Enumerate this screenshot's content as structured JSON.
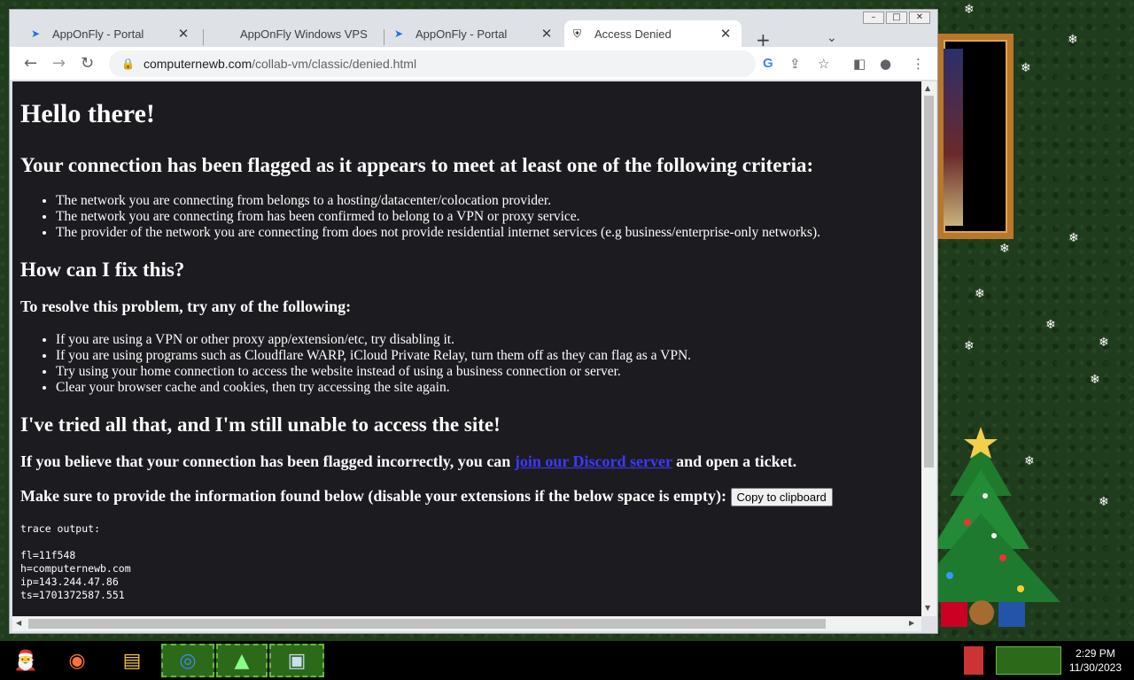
{
  "browser": {
    "tabs": [
      {
        "title": "AppOnFly - Portal",
        "active": false
      },
      {
        "title": "AppOnFly Windows VPS",
        "active": false
      },
      {
        "title": "AppOnFly - Portal",
        "active": false
      },
      {
        "title": "Access Denied",
        "active": true
      }
    ],
    "url_host": "computernewb.com",
    "url_path": "/collab-vm/classic/denied.html"
  },
  "page": {
    "heading": "Hello there!",
    "flagged_heading": "Your connection has been flagged as it appears to meet at least one of the following criteria:",
    "criteria": [
      "The network you are connecting from belongs to a hosting/datacenter/colocation provider.",
      "The network you are connecting from has been confirmed to belong to a VPN or proxy service.",
      "The provider of the network you are connecting from does not provide residential internet services (e.g business/enterprise-only networks)."
    ],
    "fix_heading": "How can I fix this?",
    "resolve_heading": "To resolve this problem, try any of the following:",
    "fixes": [
      "If you are using a VPN or other proxy app/extension/etc, try disabling it.",
      "If you are using programs such as Cloudflare WARP, iCloud Private Relay, turn them off as they can flag as a VPN.",
      "Try using your home connection to access the website instead of using a business connection or server.",
      "Clear your browser cache and cookies, then try accessing the site again."
    ],
    "tried_heading": "I've tried all that, and I'm still unable to access the site!",
    "incorrect_prefix": "If you believe that your connection has been flagged incorrectly, you can",
    "discord_link": "join our Discord server",
    "incorrect_suffix": "and open a ticket.",
    "info_text": "Make sure to provide the information found below (disable your extensions if the below space is empty):",
    "copy_button": "Copy to clipboard",
    "trace": "trace output:\n\nfl=11f548\nh=computernewb.com\nip=143.244.47.86\nts=1701372587.551"
  },
  "taskbar": {
    "time": "2:29 PM",
    "date": "11/30/2023"
  }
}
